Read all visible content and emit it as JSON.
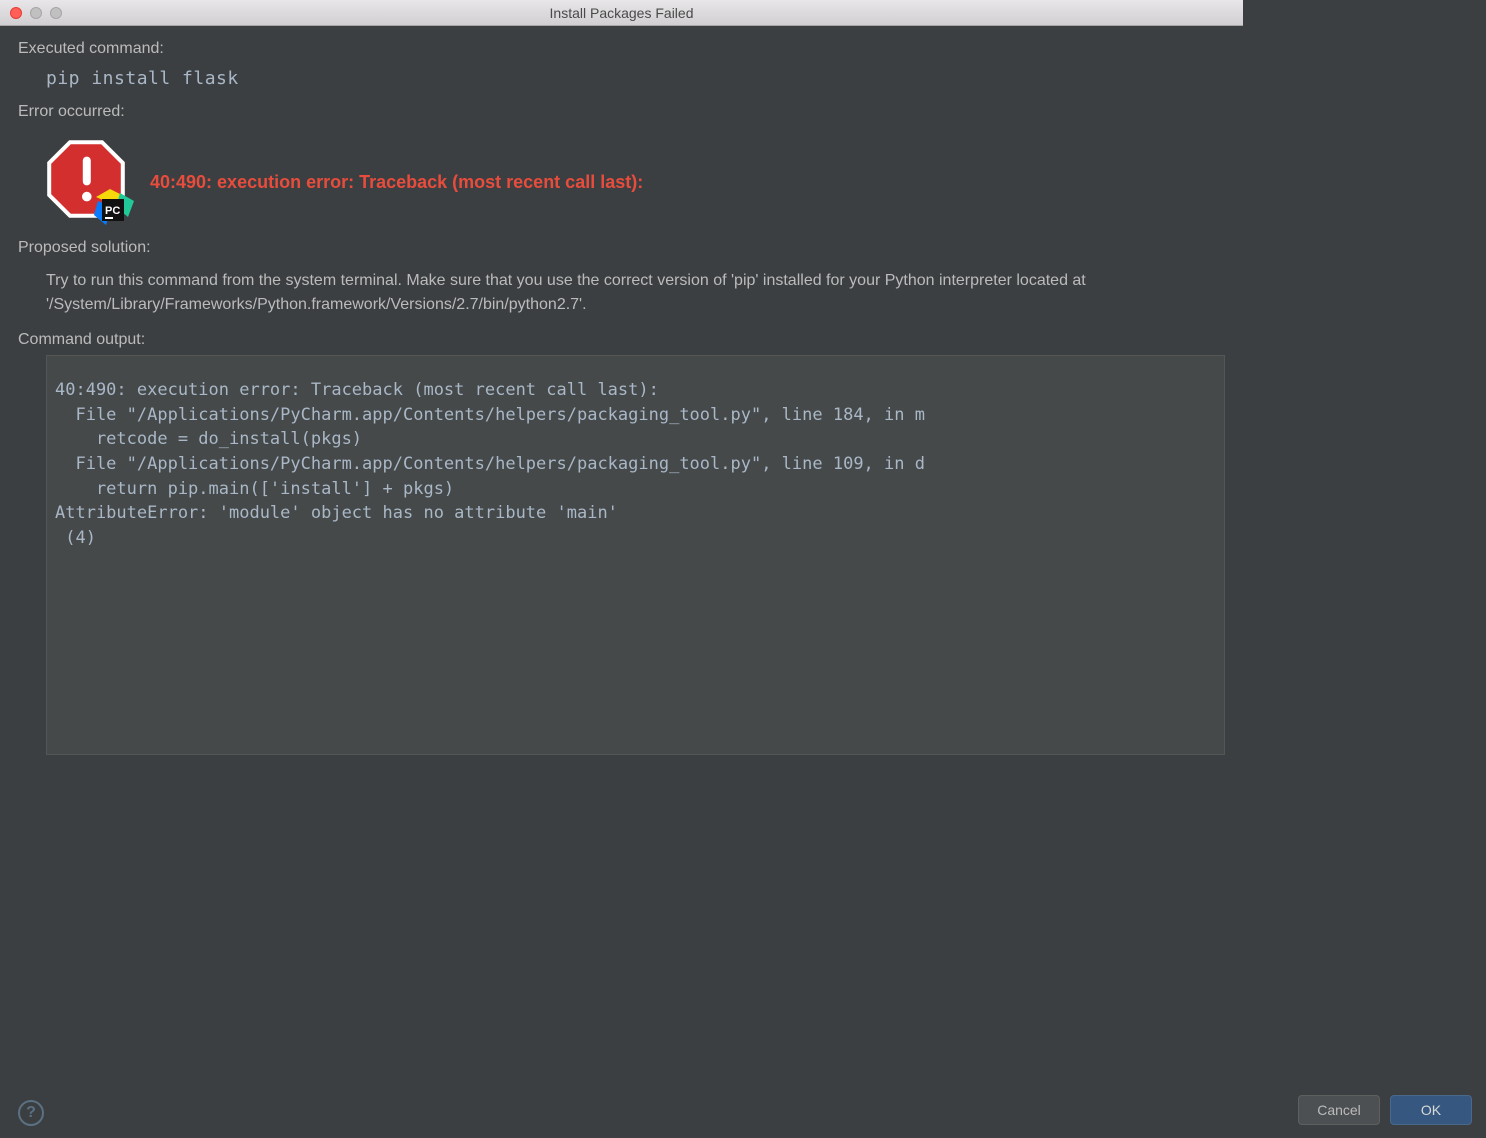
{
  "window": {
    "title": "Install Packages Failed"
  },
  "sections": {
    "executed_label": "Executed command:",
    "executed_value": "pip install flask",
    "error_label": "Error occurred:",
    "error_text": "40:490: execution error: Traceback (most recent call last):",
    "proposed_label": "Proposed solution:",
    "proposed_text": "Try to run this command from the system terminal. Make sure that you use the correct version of 'pip' installed for your Python interpreter located at '/System/Library/Frameworks/Python.framework/Versions/2.7/bin/python2.7'.",
    "output_label": "Command output:",
    "output_text": "40:490: execution error: Traceback (most recent call last):\n  File \"/Applications/PyCharm.app/Contents/helpers/packaging_tool.py\", line 184, in m\n    retcode = do_install(pkgs)\n  File \"/Applications/PyCharm.app/Contents/helpers/packaging_tool.py\", line 109, in d\n    return pip.main(['install'] + pkgs)\nAttributeError: 'module' object has no attribute 'main'\n (4)"
  },
  "icons": {
    "pycharm_badge_text": "PC"
  },
  "buttons": {
    "help": "?",
    "cancel": "Cancel",
    "ok": "OK"
  }
}
